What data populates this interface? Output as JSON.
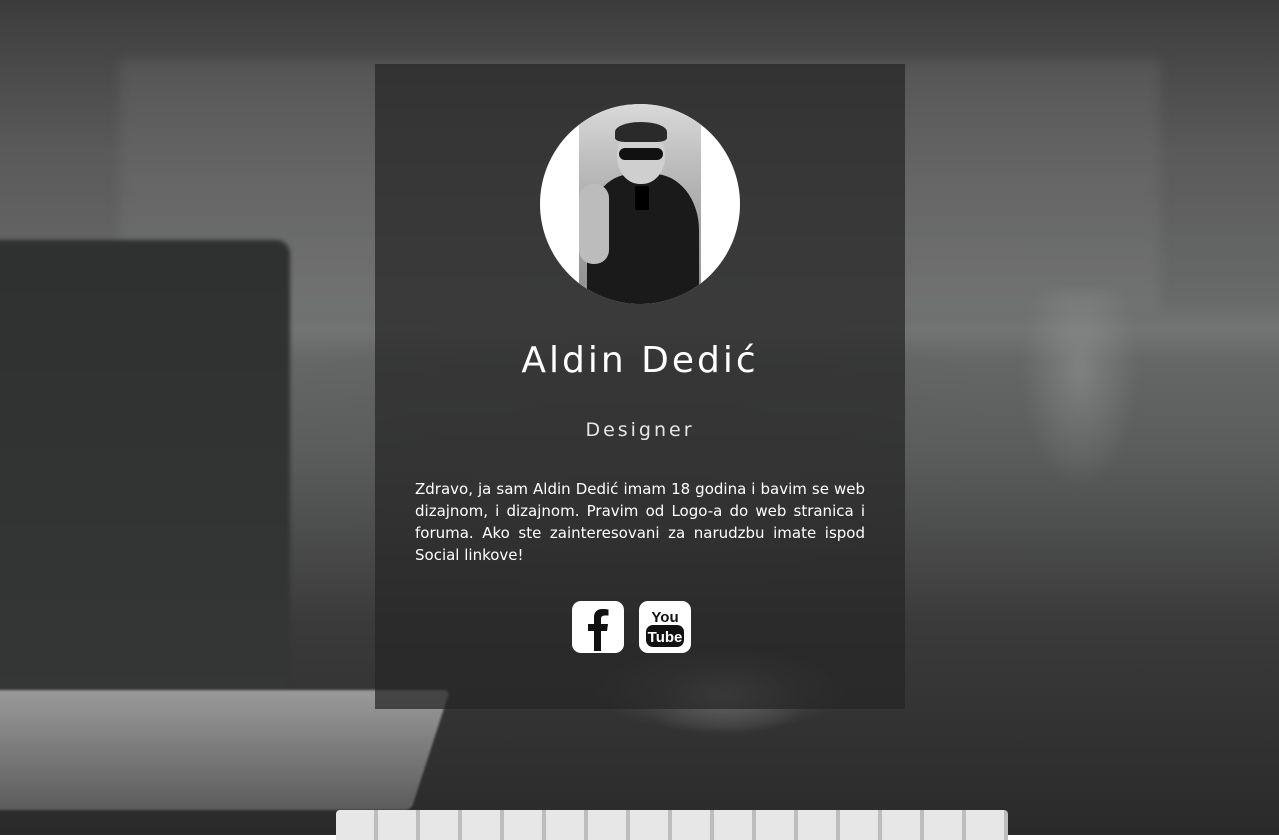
{
  "profile": {
    "name": "Aldin Dedić",
    "role": "Designer",
    "bio": "Zdravo, ja sam Aldin Dedić imam 18 godina i bavim se web dizajnom, i dizajnom. Pravim od Logo-a do web stranica i foruma. Ako ste zainteresovani za narudzbu imate ispod Social linkove!"
  },
  "social": {
    "facebook_icon": "facebook-icon",
    "youtube_icon": "youtube-icon",
    "youtube_word_top": "You",
    "youtube_word_bottom": "Tube"
  }
}
